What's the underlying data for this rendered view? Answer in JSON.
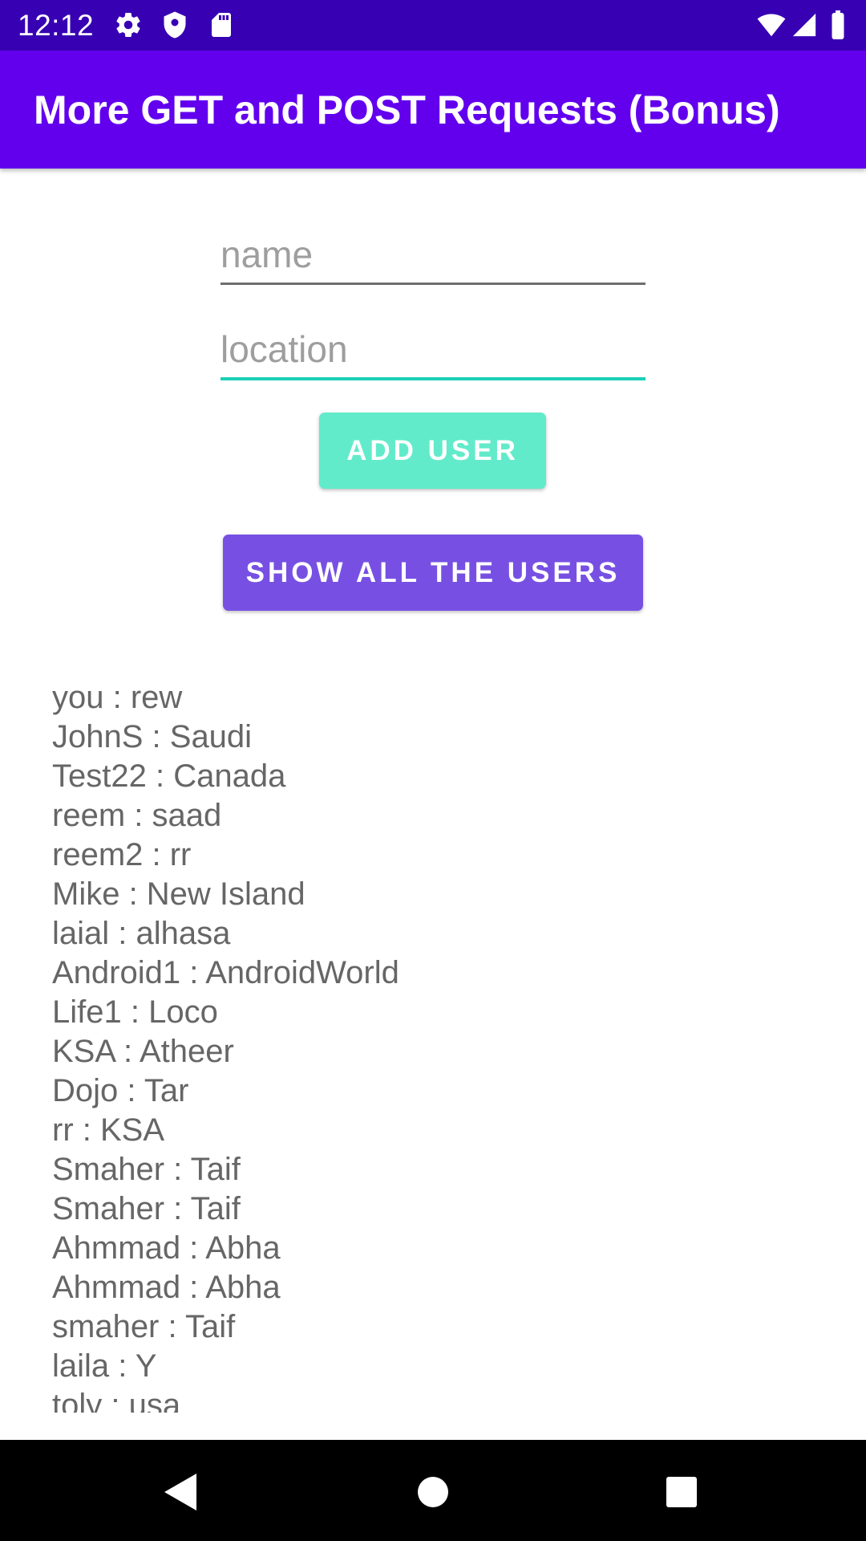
{
  "status_bar": {
    "time": "12:12",
    "left_icons": [
      "gear-icon",
      "shield-icon",
      "sd-card-icon"
    ],
    "right_icons": [
      "wifi-icon",
      "cellular-signal-icon",
      "battery-icon"
    ]
  },
  "app_bar": {
    "title": "More GET and POST Requests (Bonus)"
  },
  "form": {
    "name_placeholder": "name",
    "name_value": "",
    "location_placeholder": "location",
    "location_value": "",
    "add_user_label": "ADD USER",
    "show_all_label": "SHOW ALL THE USERS"
  },
  "users": [
    "you : rew",
    "JohnS : Saudi",
    "Test22 : Canada",
    "reem : saad",
    "reem2 : rr",
    "Mike : New Island",
    "laial : alhasa",
    "Android1 : AndroidWorld",
    "Life1 : Loco",
    "KSA : Atheer",
    "Dojo : Tar",
    "rr : KSA",
    "Smaher : Taif",
    "Smaher : Taif",
    "Ahmmad : Abha",
    "Ahmmad : Abha",
    "smaher : Taif",
    "laila : Y",
    "toly : usa"
  ],
  "nav_bar": {
    "icons": [
      "back-icon",
      "home-icon",
      "recents-icon"
    ]
  },
  "colors": {
    "status_bar": "#3700b3",
    "app_bar": "#6200ee",
    "add_button": "#62ebcb",
    "show_button": "#7750e3",
    "focused_underline": "#1ccfb8",
    "idle_underline": "#6e6e6e"
  }
}
